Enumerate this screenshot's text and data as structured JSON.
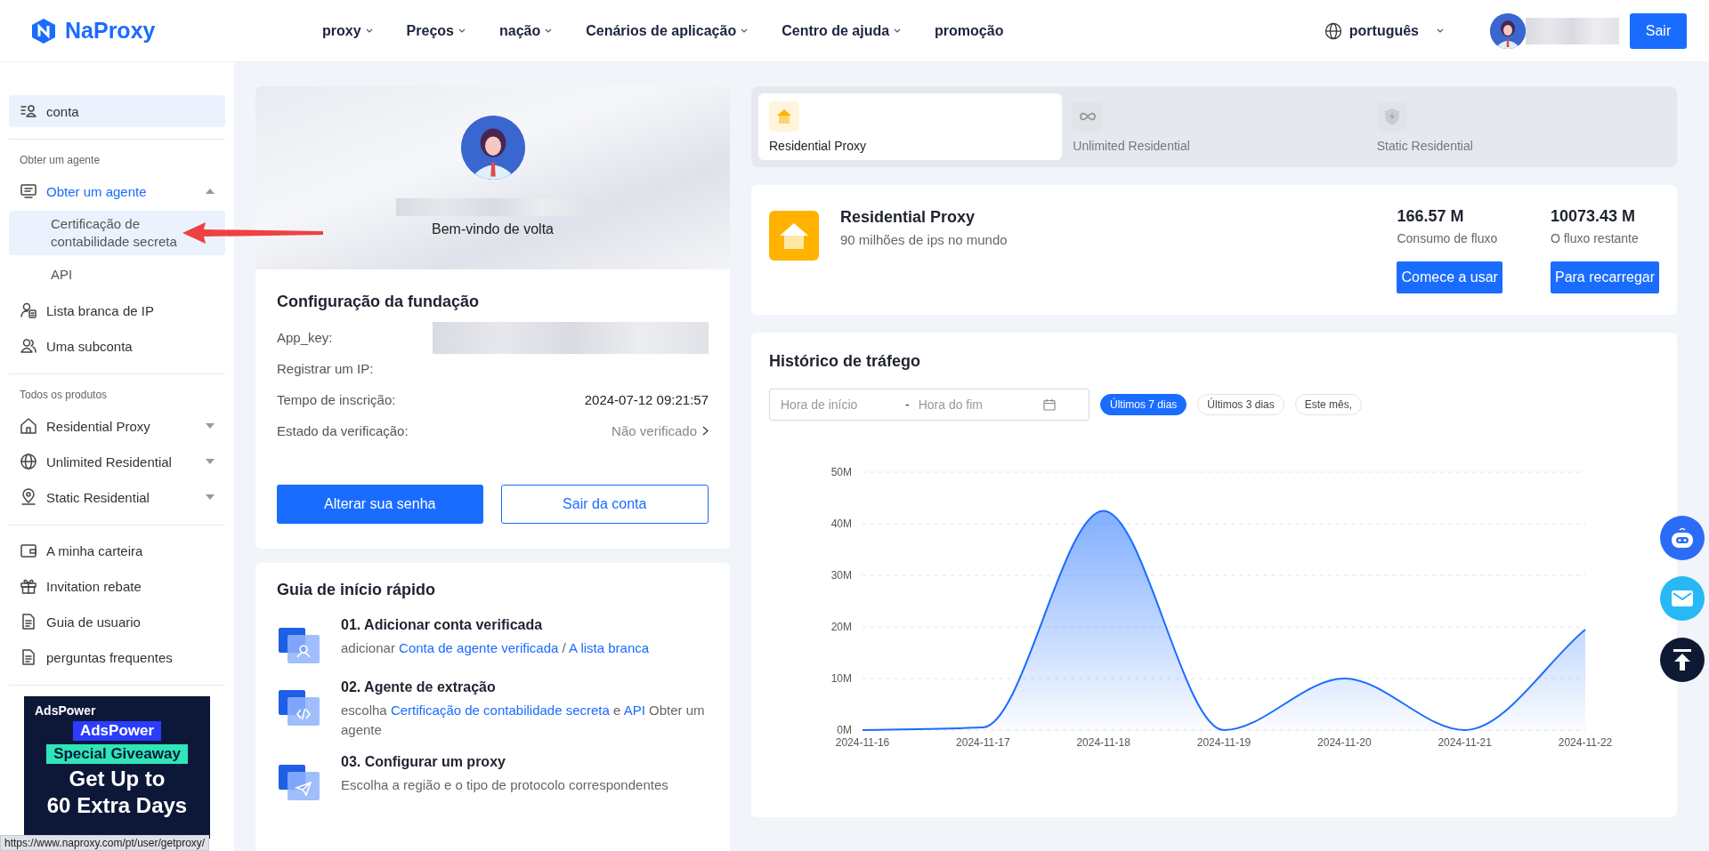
{
  "header": {
    "logo": "NaProxy",
    "nav": [
      {
        "label": "proxy",
        "dropdown": true
      },
      {
        "label": "Preços",
        "dropdown": true
      },
      {
        "label": "nação",
        "dropdown": true
      },
      {
        "label": "Cenários de aplicação",
        "dropdown": true
      },
      {
        "label": "Centro de ajuda",
        "dropdown": true
      },
      {
        "label": "promoção",
        "dropdown": false
      }
    ],
    "language": "português",
    "logout": "Sair"
  },
  "sidebar": {
    "sections": [
      {
        "items": [
          {
            "label": "conta",
            "selected": true
          }
        ]
      },
      {
        "heading": "Obter um agente",
        "items": [
          {
            "label": "Obter um agente",
            "selected": false,
            "expanded": true,
            "children": [
              {
                "label": "Certificação de contabilidade secreta",
                "selected": true
              },
              {
                "label": "API",
                "selected": false
              }
            ]
          },
          {
            "label": "Lista branca de IP",
            "selected": false
          },
          {
            "label": "Uma subconta",
            "selected": false
          }
        ]
      },
      {
        "heading": "Todos os produtos",
        "items": [
          {
            "label": "Residential Proxy",
            "selected": false,
            "expanded": false
          },
          {
            "label": "Unlimited Residential",
            "selected": false,
            "expanded": false
          },
          {
            "label": "Static Residential",
            "selected": false,
            "expanded": false
          }
        ]
      },
      {
        "items": [
          {
            "label": "A minha carteira",
            "selected": false
          },
          {
            "label": "Invitation rebate",
            "selected": false
          },
          {
            "label": "Guia de usuario",
            "selected": false
          },
          {
            "label": "perguntas frequentes",
            "selected": false
          }
        ]
      }
    ],
    "banner": {
      "brand": "AdsPower",
      "tag": "AdsPower",
      "ribbon": "Special Giveaway",
      "headline": "Get Up to",
      "subline": "60 Extra Days"
    }
  },
  "profile": {
    "greeting": "Bem-vindo de volta"
  },
  "config": {
    "title": "Configuração da fundação",
    "fields": [
      {
        "label": "App_key:",
        "kind": "redacted"
      },
      {
        "label": "Registrar um IP:",
        "kind": "empty"
      },
      {
        "label": "Tempo de inscrição:",
        "kind": "text",
        "value": "2024-07-12 09:21:57"
      },
      {
        "label": "Estado da verificação:",
        "kind": "link",
        "value": "Não verificado"
      }
    ],
    "buttons": [
      {
        "label": "Alterar sua senha",
        "kind": "primary"
      },
      {
        "label": "Sair da conta",
        "kind": "outline"
      }
    ]
  },
  "guide": {
    "title": "Guia de início rápido",
    "steps": [
      {
        "title": "01. Adicionar conta verificada",
        "parts": [
          {
            "text": "adicionar ",
            "link": false
          },
          {
            "text": "Conta de agente verificada",
            "link": true
          },
          {
            "text": " / ",
            "link": false
          },
          {
            "text": "A lista branca",
            "link": true
          }
        ]
      },
      {
        "title": "02. Agente de extração",
        "parts": [
          {
            "text": "escolha ",
            "link": false
          },
          {
            "text": "Certificação de contabilidade secreta",
            "link": true
          },
          {
            "text": " e ",
            "link": false
          },
          {
            "text": "API",
            "link": true
          },
          {
            "text": " Obter um agente",
            "link": false
          }
        ]
      },
      {
        "title": "03. Configurar um proxy",
        "parts": [
          {
            "text": "Escolha a região e o tipo de protocolo correspondentes",
            "link": false
          }
        ]
      }
    ]
  },
  "tabs": [
    {
      "label": "Residential Proxy",
      "selected": true
    },
    {
      "label": "Unlimited Residential",
      "selected": false
    },
    {
      "label": "Static Residential",
      "selected": false
    }
  ],
  "product": {
    "title": "Residential Proxy",
    "subtitle": "90 milhões de ips no mundo",
    "stats": [
      {
        "value": "166.57 M",
        "label": "Consumo de fluxo",
        "button": "Comece a usar"
      },
      {
        "value": "10073.43 M",
        "label": "O fluxo restante",
        "button": "Para recarregar"
      }
    ]
  },
  "traffic": {
    "title": "Histórico de tráfego",
    "start_placeholder": "Hora de início",
    "separator": "-",
    "end_placeholder": "Hora do fim",
    "ranges": [
      {
        "label": "Últimos 7 dias",
        "selected": true
      },
      {
        "label": "Últimos 3 dias",
        "selected": false
      },
      {
        "label": "Este mês,",
        "selected": false
      }
    ],
    "chart_data": {
      "type": "area",
      "categories": [
        "2024-11-16",
        "2024-11-17",
        "2024-11-18",
        "2024-11-19",
        "2024-11-20",
        "2024-11-21",
        "2024-11-22"
      ],
      "values": [
        0,
        0.5,
        42.5,
        0,
        10,
        0,
        19.5
      ],
      "grid": true,
      "ylim": [
        0,
        50
      ],
      "yticks": [
        {
          "value": 0,
          "label": "0M"
        },
        {
          "value": 10,
          "label": "10M"
        },
        {
          "value": 20,
          "label": "20M"
        },
        {
          "value": 30,
          "label": "30M"
        },
        {
          "value": 40,
          "label": "40M"
        },
        {
          "value": 50,
          "label": "50M"
        }
      ]
    }
  },
  "status_url": "https://www.naproxy.com/pt/user/getproxy/"
}
